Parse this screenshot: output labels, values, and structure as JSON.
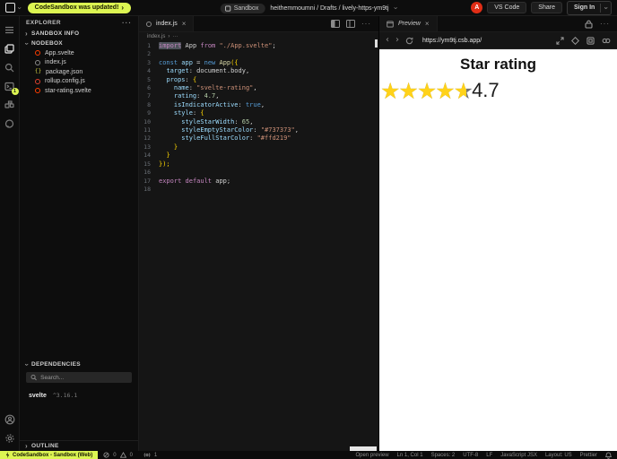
{
  "topbar": {
    "update_banner": "CodeSandbox was updated!",
    "sandbox_badge": "Sandbox",
    "breadcrumb": "heithemmoumni / Drafts / lively-https-ym9tj",
    "avatar_letter": "A",
    "vscode_button": "VS Code",
    "share_button": "Share",
    "signin_button": "Sign In"
  },
  "activitybar": {
    "terminal_badge": "1"
  },
  "sidebar": {
    "explorer_title": "EXPLORER",
    "sandbox_info_label": "SANDBOX INFO",
    "nodebox_label": "NODEBOX",
    "files": [
      {
        "name": "App.svelte",
        "type": "svelte",
        "color": "#ff3e00"
      },
      {
        "name": "index.js",
        "type": "js",
        "color": "#8a8a8a"
      },
      {
        "name": "package.json",
        "type": "json",
        "color": "#cbcb41"
      },
      {
        "name": "rollup.config.js",
        "type": "config",
        "color": "#e0412e"
      },
      {
        "name": "star-rating.svelte",
        "type": "svelte",
        "color": "#ff3e00"
      }
    ],
    "dependencies_label": "DEPENDENCIES",
    "search_placeholder": "Search...",
    "dependency": {
      "name": "svelte",
      "version": "^3.16.1"
    },
    "outline_label": "OUTLINE"
  },
  "editor": {
    "tab_label": "index.js",
    "breadcrumb_file": "index.js",
    "palette": {
      "kw": "#c586c0",
      "kw2": "#569cd6",
      "plain": "#d4d4d4",
      "fn": "#dcdcaa",
      "prop": "#9cdcfe",
      "str": "#ce9178",
      "num": "#b5cea8",
      "br": "#ffd700"
    },
    "lines": [
      {
        "n": 1,
        "t": [
          [
            "import",
            "kw",
            "sel"
          ],
          [
            " ",
            "plain"
          ],
          [
            "App",
            "plain"
          ],
          [
            " ",
            "plain"
          ],
          [
            "from",
            "kw"
          ],
          [
            " ",
            "plain"
          ],
          [
            "\"./App.svelte\"",
            "str"
          ],
          [
            ";",
            "plain"
          ]
        ]
      },
      {
        "n": 2,
        "t": []
      },
      {
        "n": 3,
        "t": [
          [
            "const",
            "kw2"
          ],
          [
            " ",
            "plain"
          ],
          [
            "app",
            "prop"
          ],
          [
            " = ",
            "plain"
          ],
          [
            "new",
            "kw2"
          ],
          [
            " ",
            "plain"
          ],
          [
            "App",
            "fn"
          ],
          [
            "({",
            "br"
          ]
        ]
      },
      {
        "n": 4,
        "t": [
          [
            "  ",
            "plain"
          ],
          [
            "target",
            "prop"
          ],
          [
            ": document.body,",
            "plain"
          ]
        ]
      },
      {
        "n": 5,
        "t": [
          [
            "  ",
            "plain"
          ],
          [
            "props",
            "prop"
          ],
          [
            ": ",
            "plain"
          ],
          [
            "{",
            "br"
          ]
        ]
      },
      {
        "n": 6,
        "t": [
          [
            "    ",
            "plain"
          ],
          [
            "name",
            "prop"
          ],
          [
            ": ",
            "plain"
          ],
          [
            "\"svelte-rating\"",
            "str"
          ],
          [
            ",",
            "plain"
          ]
        ]
      },
      {
        "n": 7,
        "t": [
          [
            "    ",
            "plain"
          ],
          [
            "rating",
            "prop"
          ],
          [
            ": ",
            "plain"
          ],
          [
            "4.7",
            "num"
          ],
          [
            ",",
            "plain"
          ]
        ]
      },
      {
        "n": 8,
        "t": [
          [
            "    ",
            "plain"
          ],
          [
            "isIndicatorActive",
            "prop"
          ],
          [
            ": ",
            "plain"
          ],
          [
            "true",
            "kw2"
          ],
          [
            ",",
            "plain"
          ]
        ]
      },
      {
        "n": 9,
        "t": [
          [
            "    ",
            "plain"
          ],
          [
            "style",
            "prop"
          ],
          [
            ": ",
            "plain"
          ],
          [
            "{",
            "br"
          ]
        ]
      },
      {
        "n": 10,
        "t": [
          [
            "      ",
            "plain"
          ],
          [
            "styleStarWidth",
            "prop"
          ],
          [
            ": ",
            "plain"
          ],
          [
            "65",
            "num"
          ],
          [
            ",",
            "plain"
          ]
        ]
      },
      {
        "n": 11,
        "t": [
          [
            "      ",
            "plain"
          ],
          [
            "styleEmptyStarColor",
            "prop"
          ],
          [
            ": ",
            "plain"
          ],
          [
            "\"#737373\"",
            "str"
          ],
          [
            ",",
            "plain"
          ]
        ]
      },
      {
        "n": 12,
        "t": [
          [
            "      ",
            "plain"
          ],
          [
            "styleFullStarColor",
            "prop"
          ],
          [
            ": ",
            "plain"
          ],
          [
            "\"#ffd219\"",
            "str"
          ]
        ]
      },
      {
        "n": 13,
        "t": [
          [
            "    ",
            "plain"
          ],
          [
            "}",
            "br"
          ]
        ]
      },
      {
        "n": 14,
        "t": [
          [
            "  ",
            "plain"
          ],
          [
            "}",
            "br"
          ]
        ]
      },
      {
        "n": 15,
        "t": [
          [
            "});",
            "br"
          ]
        ]
      },
      {
        "n": 16,
        "t": []
      },
      {
        "n": 17,
        "t": [
          [
            "export",
            "kw"
          ],
          [
            " ",
            "plain"
          ],
          [
            "default",
            "kw"
          ],
          [
            " ",
            "plain"
          ],
          [
            "app",
            "plain"
          ],
          [
            ";",
            "plain"
          ]
        ]
      },
      {
        "n": 18,
        "t": []
      }
    ]
  },
  "preview": {
    "tab_label": "Preview",
    "url": "https://ym9tj.csb.app/",
    "content": {
      "title": "Star rating",
      "stars": "★★★★★",
      "rating": "4.7",
      "rating_percent": 94,
      "full_color": "#ffd219",
      "empty_color": "#737373"
    }
  },
  "statusbar": {
    "workspace_label": "CodeSandbox - Sandbox (Web)",
    "errors": "0",
    "warnings": "0",
    "ports": "1",
    "right_items": [
      "Open preview",
      "Ln 1, Col 1",
      "Spaces: 2",
      "UTF-8",
      "LF",
      "JavaScript JSX",
      "Layout: US",
      "Prettier"
    ]
  }
}
